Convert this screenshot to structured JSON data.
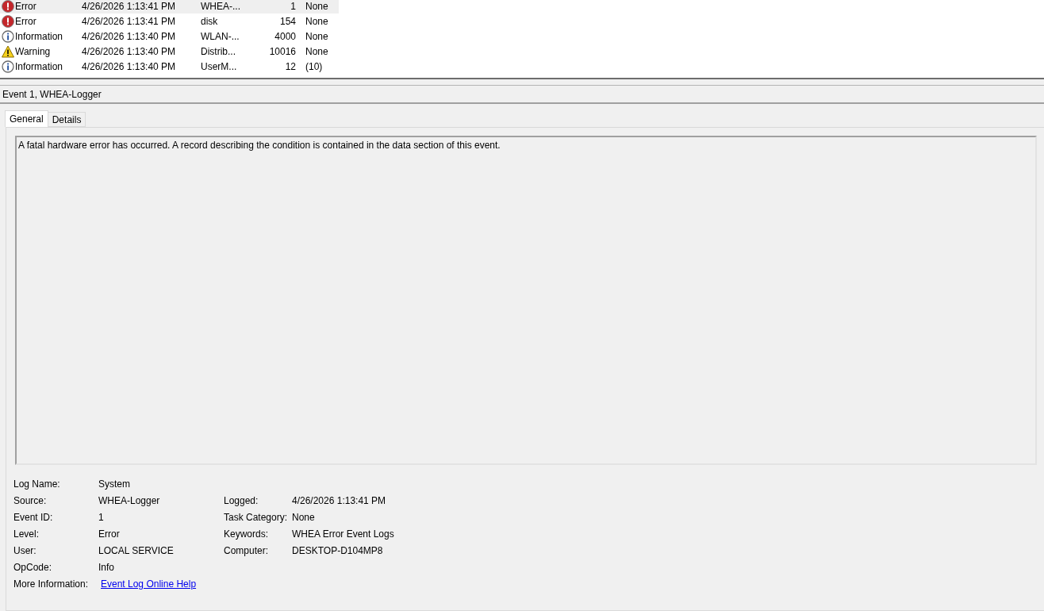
{
  "events": [
    {
      "level": "Error",
      "kind": "error",
      "date": "4/26/2026 1:13:41 PM",
      "source": "WHEA-...",
      "event_id": "1",
      "task": "None",
      "selected": true
    },
    {
      "level": "Error",
      "kind": "error",
      "date": "4/26/2026 1:13:41 PM",
      "source": "disk",
      "event_id": "154",
      "task": "None",
      "selected": false
    },
    {
      "level": "Information",
      "kind": "info",
      "date": "4/26/2026 1:13:40 PM",
      "source": "WLAN-...",
      "event_id": "4000",
      "task": "None",
      "selected": false
    },
    {
      "level": "Warning",
      "kind": "warning",
      "date": "4/26/2026 1:13:40 PM",
      "source": "Distrib...",
      "event_id": "10016",
      "task": "None",
      "selected": false
    },
    {
      "level": "Information",
      "kind": "info",
      "date": "4/26/2026 1:13:40 PM",
      "source": "UserM...",
      "event_id": "12",
      "task": "(10)",
      "selected": false
    }
  ],
  "detail_title": "Event 1, WHEA-Logger",
  "tabs": [
    {
      "label": "General",
      "selected": true
    },
    {
      "label": "Details",
      "selected": false
    }
  ],
  "description": "A fatal hardware error has occurred. A record describing the condition is contained in the data section of this event.",
  "fields": [
    {
      "left": {
        "label": "Log Name:",
        "value": "System"
      }
    },
    {
      "left": {
        "label": "Source:",
        "value": "WHEA-Logger"
      },
      "right": {
        "label": "Logged:",
        "value": "4/26/2026 1:13:41 PM"
      }
    },
    {
      "left": {
        "label": "Event ID:",
        "value": "1"
      },
      "right": {
        "label": "Task Category:",
        "value": "None"
      }
    },
    {
      "left": {
        "label": "Level:",
        "value": "Error"
      },
      "right": {
        "label": "Keywords:",
        "value": "WHEA Error Event Logs"
      }
    },
    {
      "left": {
        "label": "User:",
        "value": "LOCAL SERVICE"
      },
      "right": {
        "label": "Computer:",
        "value": "DESKTOP-D104MP8"
      }
    },
    {
      "left": {
        "label": "OpCode:",
        "value": "Info"
      }
    },
    {
      "left": {
        "label": "More Information:",
        "value": "Event Log Online Help",
        "kind": "link"
      }
    }
  ]
}
